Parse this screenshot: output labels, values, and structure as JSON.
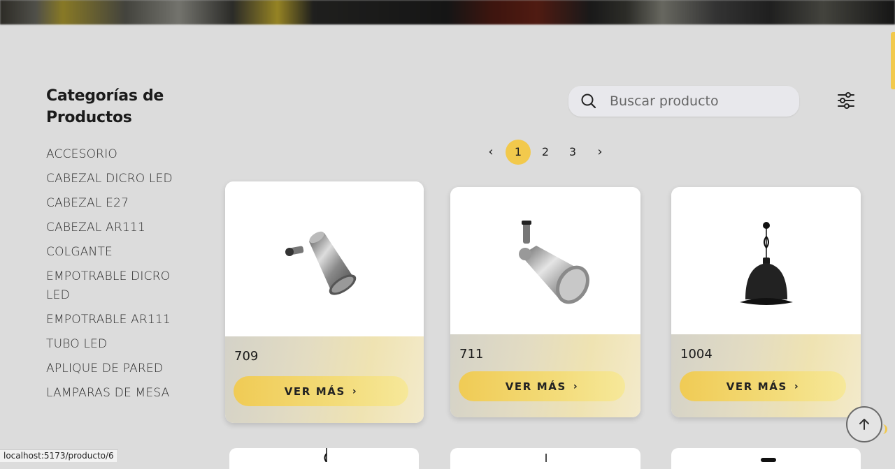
{
  "sidebar": {
    "title": "Categorías de Productos",
    "categories": [
      "ACCESORIO",
      "CABEZAL DICRO LED",
      "CABEZAL E27",
      "CABEZAL AR111",
      "COLGANTE",
      "EMPOTRABLE DICRO LED",
      "EMPOTRABLE AR111",
      "TUBO LED",
      "APLIQUE DE PARED",
      "LAMPARAS DE MESA"
    ]
  },
  "search": {
    "placeholder": "Buscar producto",
    "value": ""
  },
  "pagination": {
    "prev": "‹",
    "next": "›",
    "pages": [
      "1",
      "2",
      "3"
    ],
    "current": "1"
  },
  "products": [
    {
      "code": "709",
      "button": "VER MÁS",
      "image": "chrome-spotlight-head"
    },
    {
      "code": "711",
      "button": "VER MÁS",
      "image": "chrome-cone-spotlight"
    },
    {
      "code": "1004",
      "button": "VER MÁS",
      "image": "black-pendant-lamp"
    }
  ],
  "status_url": "localhost:5173/producto/6",
  "colors": {
    "accent": "#f2c94c",
    "background": "#dcdcdc"
  },
  "icons": {
    "search": "search-icon",
    "filter": "sliders-icon",
    "back_to_top": "arrow-up-icon",
    "chevron": "chevron-right-icon"
  }
}
